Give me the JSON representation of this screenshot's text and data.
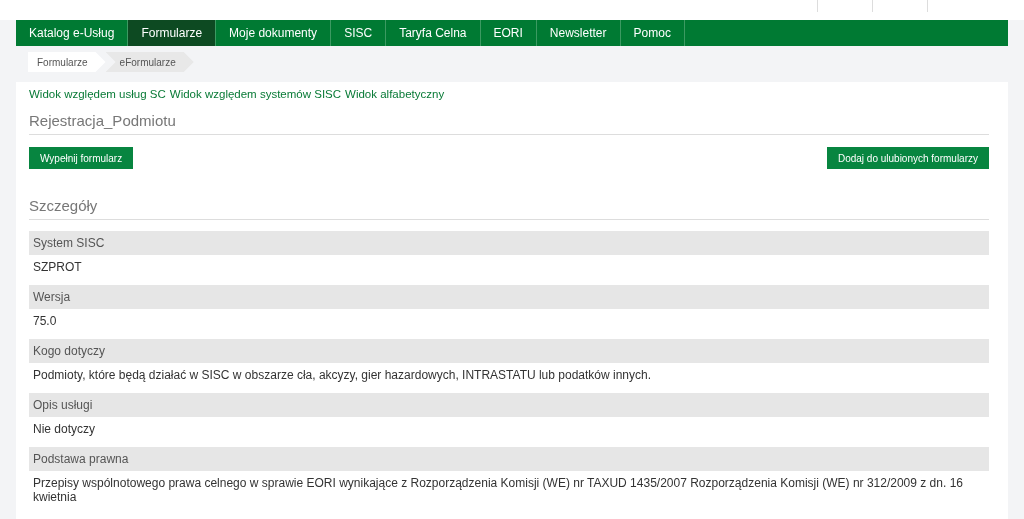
{
  "nav": [
    {
      "label": "Katalog e-Usług",
      "selected": false
    },
    {
      "label": "Formularze",
      "selected": true
    },
    {
      "label": "Moje dokumenty",
      "selected": false
    },
    {
      "label": "SISC",
      "selected": false
    },
    {
      "label": "Taryfa Celna",
      "selected": false
    },
    {
      "label": "EORI",
      "selected": false
    },
    {
      "label": "Newsletter",
      "selected": false
    },
    {
      "label": "Pomoc",
      "selected": false
    }
  ],
  "breadcrumb": [
    "Formularze",
    "eFormularze"
  ],
  "view_links": [
    "Widok względem usług SC",
    "Widok względem systemów SISC",
    "Widok alfabetyczny"
  ],
  "form_title": "Rejestracja_Podmiotu",
  "buttons": [
    "Wypełnij formularz",
    "Dodaj do ulubionych formularzy"
  ],
  "details_title": "Szczegóły",
  "details": [
    {
      "label": "System SISC",
      "value": "SZPROT"
    },
    {
      "label": "Wersja",
      "value": "75.0"
    },
    {
      "label": "Kogo dotyczy",
      "value": "Podmioty, które będą działać w SISC w obszarze cła, akcyzy, gier hazardowych, INTRASTATU lub podatków innych."
    },
    {
      "label": "Opis usługi",
      "value": "Nie dotyczy"
    },
    {
      "label": "Podstawa prawna",
      "value": "Przepisy wspólnotowego prawa celnego w sprawie EORI wynikające z Rozporządzenia Komisji (WE) nr TAXUD 1435/2007 Rozporządzenia Komisji (WE) nr 312/2009 z dn. 16 kwietnia"
    }
  ]
}
